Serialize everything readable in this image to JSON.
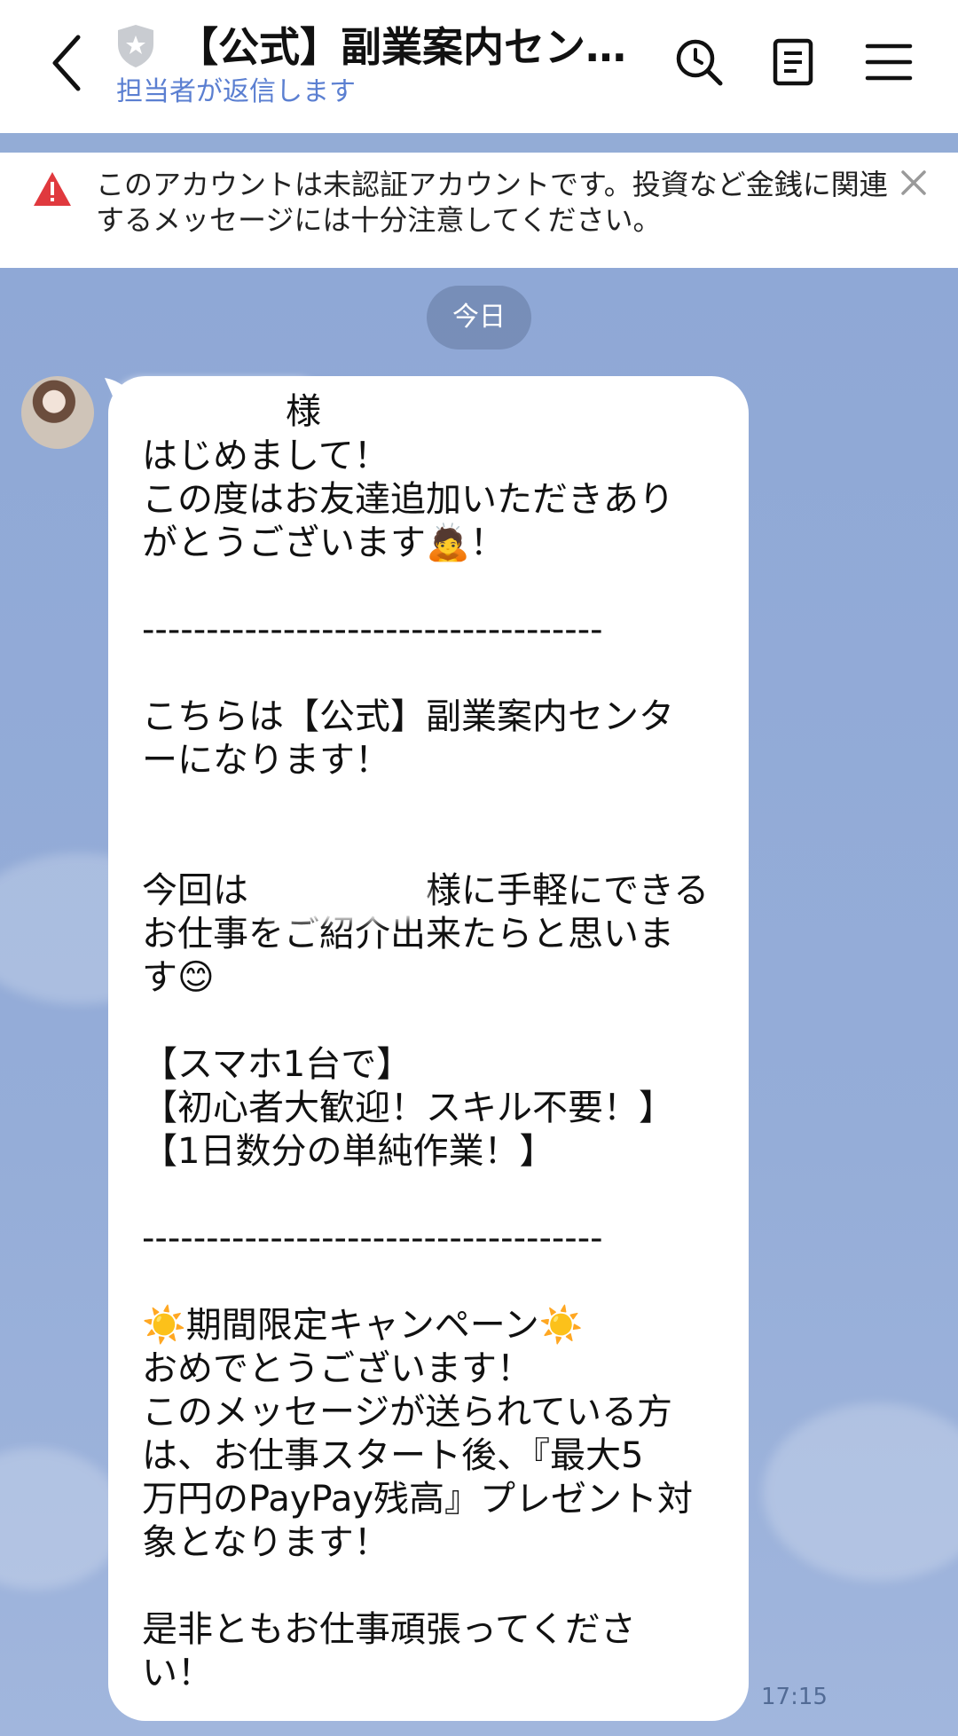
{
  "header": {
    "title": "【公式】副業案内セン…",
    "subtitle": "担当者が返信します",
    "back_icon": "chevron-left-icon",
    "search_icon": "search-icon",
    "notes_icon": "note-icon",
    "menu_icon": "hamburger-menu-icon"
  },
  "notice": {
    "text": "このアカウントは未認証アカウントです。投資など金銭に関連するメッセージには十分注意してください。",
    "warning_color": "#e0393e"
  },
  "chat": {
    "date_label": "今日",
    "message": {
      "name_suffix": "様",
      "body": "はじめまして！\nこの度はお友達追加いただきあり\nがとうございます🙇！\n\n------------------------------------\n\nこちらは【公式】副業案内センタ\nーになります！\n\n\n今回は　　　　　様に手軽にできる\nお仕事をご紹介出来たらと思いま\nす😊\n\n【スマホ1台で】\n【初心者大歓迎！スキル不要！】\n【1日数分の単純作業！】\n\n------------------------------------\n\n☀️期間限定キャンペーン☀️\nおめでとうございます！\nこのメッセージが送られている方\nは、お仕事スタート後、『最大5\n万円のPayPay残高』プレゼント対\n象となります！\n\n是非ともお仕事頑張ってくださ\nい！",
      "time": "17:15"
    }
  },
  "colors": {
    "chat_background": "#93acd6",
    "subtitle": "#5b7fd1",
    "bubble": "#ffffff"
  }
}
